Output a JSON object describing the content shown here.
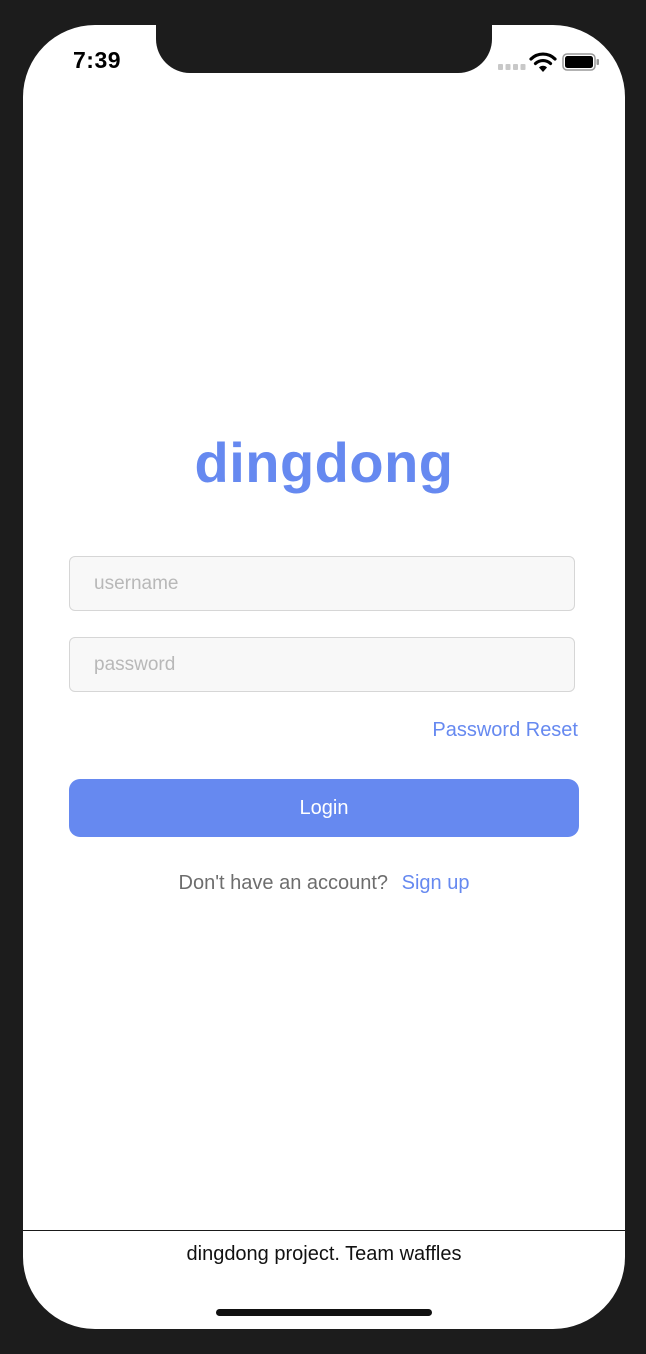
{
  "status_bar": {
    "time": "7:39",
    "signal_icon": "cellular-signal-icon",
    "wifi_icon": "wifi-icon",
    "battery_icon": "battery-icon"
  },
  "app": {
    "title": "dingdong"
  },
  "login_form": {
    "username": {
      "value": "",
      "placeholder": "username"
    },
    "password": {
      "value": "",
      "placeholder": "password"
    },
    "password_reset_label": "Password Reset",
    "login_label": "Login",
    "signup_prompt": "Don't have an account?",
    "signup_label": "Sign up"
  },
  "footer": {
    "text": "dingdong project. Team waffles"
  },
  "colors": {
    "accent": "#6689f0",
    "field_background": "#f8f8f8",
    "field_border": "#d6d6d6",
    "device_frame": "#1c1c1c"
  }
}
